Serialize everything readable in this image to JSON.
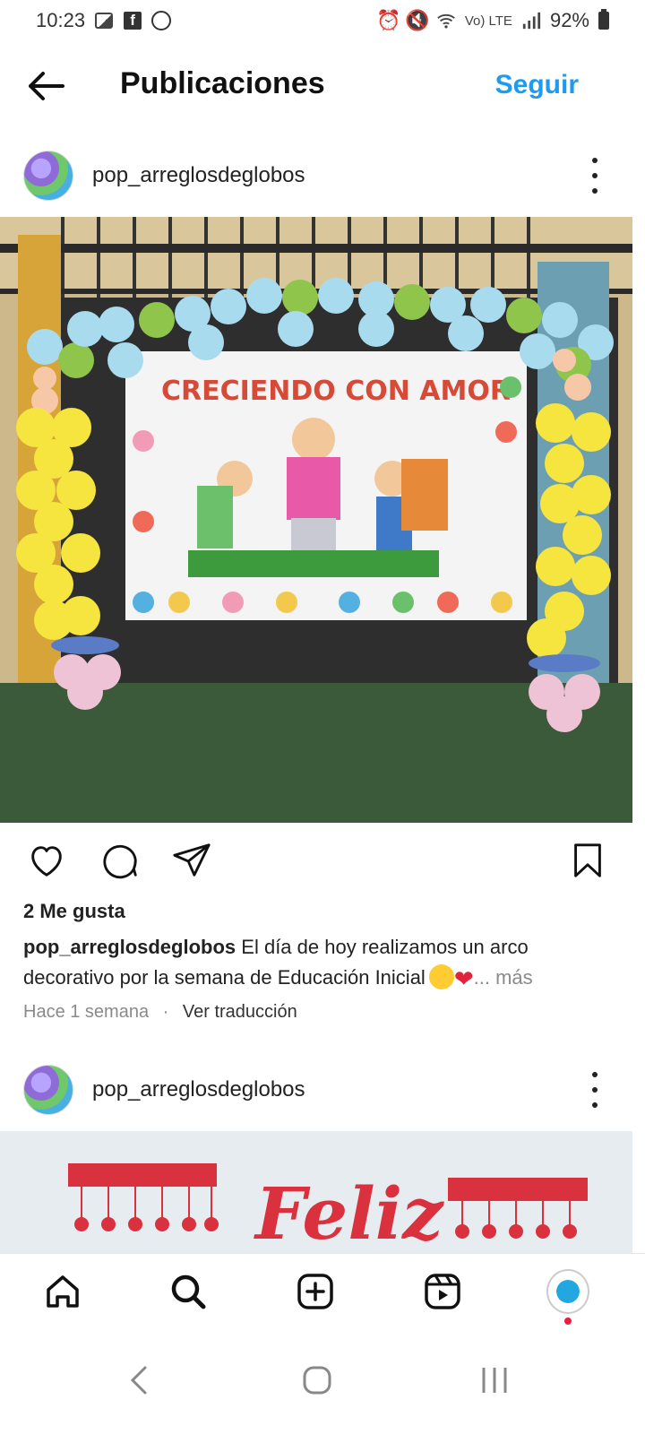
{
  "status_bar": {
    "time": "10:23",
    "network": "Vo) LTE",
    "battery_pct": "92%",
    "left_icons": [
      "image-icon",
      "facebook-icon",
      "whatsapp-icon"
    ],
    "right_icons": [
      "alarm-icon",
      "mute-icon",
      "wifi-icon",
      "signal-icon",
      "battery-icon"
    ]
  },
  "header": {
    "title": "Publicaciones",
    "follow_label": "Seguir",
    "back_icon": "arrow-left-icon"
  },
  "post1": {
    "username": "pop_arreglosdeglobos",
    "banner_text": "CRECIENDO CON AMOR",
    "likes": "2 Me gusta",
    "caption_user": "pop_arreglosdeglobos",
    "caption_text": "El día de hoy realizamos un arco decorativo por la semana de Educación Inicial",
    "caption_more": "... más",
    "time_ago": "Hace 1 semana",
    "translate": "Ver traducción"
  },
  "post2": {
    "username": "pop_arreglosdeglobos",
    "banner_text": "Feliz"
  },
  "bottom_nav": [
    "home-icon",
    "search-icon",
    "create-icon",
    "reels-icon",
    "profile-icon"
  ],
  "colors": {
    "accent_blue": "#1e9bf0",
    "like_red": "#e0243b"
  }
}
